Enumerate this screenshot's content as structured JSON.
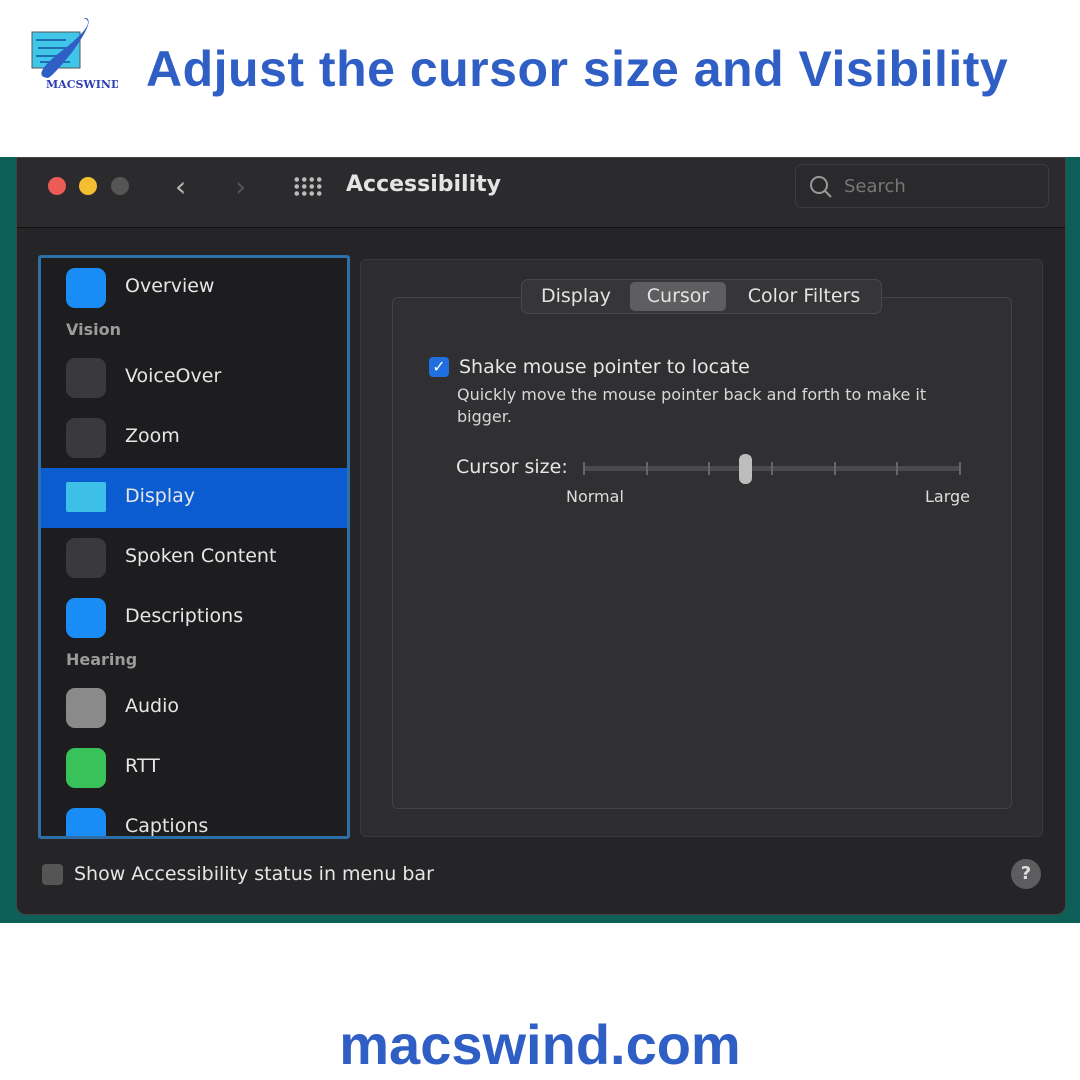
{
  "banner": {
    "title": "Adjust the cursor size and Visibility",
    "logo_text": "MACSWIND",
    "footer": "macswind.com"
  },
  "window": {
    "title": "Accessibility",
    "search_placeholder": "Search",
    "sidebar": {
      "items": [
        {
          "type": "item",
          "label": "Overview",
          "icon": "accessibility-icon",
          "color": "#1a8cf5"
        },
        {
          "type": "section",
          "label": "Vision"
        },
        {
          "type": "item",
          "label": "VoiceOver",
          "icon": "voiceover-icon",
          "color": "#3a3a3c"
        },
        {
          "type": "item",
          "label": "Zoom",
          "icon": "zoom-icon",
          "color": "#3a3a3c"
        },
        {
          "type": "item",
          "label": "Display",
          "icon": "display-icon",
          "color": "#3cc0e8",
          "selected": true
        },
        {
          "type": "item",
          "label": "Spoken Content",
          "icon": "speech-bubble-icon",
          "color": "#3a3a3c"
        },
        {
          "type": "item",
          "label": "Descriptions",
          "icon": "quote-bubble-icon",
          "color": "#1a8cf5"
        },
        {
          "type": "section",
          "label": "Hearing"
        },
        {
          "type": "item",
          "label": "Audio",
          "icon": "speaker-icon",
          "color": "#8a8a8a"
        },
        {
          "type": "item",
          "label": "RTT",
          "icon": "phone-icon",
          "color": "#3ac25a"
        },
        {
          "type": "item",
          "label": "Captions",
          "icon": "captions-icon",
          "color": "#1a8cf5"
        }
      ]
    },
    "tabs": [
      {
        "label": "Display"
      },
      {
        "label": "Cursor",
        "selected": true
      },
      {
        "label": "Color Filters"
      }
    ],
    "shake": {
      "label": "Shake mouse pointer to locate",
      "checked": true,
      "description": "Quickly move the mouse pointer back and forth to make it bigger."
    },
    "cursor_size": {
      "label": "Cursor size:",
      "min_label": "Normal",
      "max_label": "Large",
      "value_fraction": 0.43
    },
    "status_checkbox": {
      "label": "Show Accessibility status in menu bar",
      "checked": false
    },
    "help": "?"
  },
  "colors": {
    "accent": "#0b5cd0",
    "brand": "#2f5ec4"
  }
}
